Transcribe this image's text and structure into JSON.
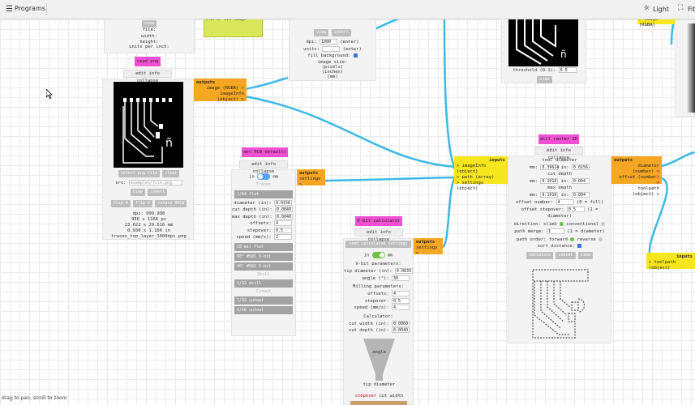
{
  "topbar": {
    "menu_icon": "hamburger-icon",
    "programs": "Programs",
    "light": "Light",
    "fit": "Fit",
    "sun_icon": "sun-icon",
    "fit_icon": "fit-icon"
  },
  "image_info_top": {
    "view": "view",
    "file": "file:",
    "width": "width:",
    "height": "height:",
    "units": "units per inch:"
  },
  "read_png": {
    "title": "read png",
    "strip": "edit info collapse",
    "select": "select png file",
    "clear": "clear",
    "src_label": "src:",
    "src_placeholder": "examples/file.png",
    "view": "view",
    "invert": "invert",
    "flip_h": "flip H",
    "flip_v": "flip V",
    "rotate": "rotate 90CW",
    "dpi": "dpi:  999.998",
    "px": "930 x 1166 px",
    "mm": "23.622 x 29.616 mm",
    "in": "0.930 x 1.166 in",
    "filename": "traces_top_layer_1000dpi.png"
  },
  "read_png_outputs": {
    "title": "outputs",
    "o1": "image (RGBA) >",
    "o2": "imageInfo (object) >"
  },
  "note_box": {
    "text": "PNG or SVG image"
  },
  "convert": {
    "view": "view",
    "invert": "invert",
    "dpi_label": "dpi:",
    "dpi_val": "1000",
    "dpi_note": "(enter)",
    "units_label": "units:",
    "units_note": "(enter)",
    "fill": "fill background:",
    "image_size": "image size:",
    "pixels": "(pixels)",
    "inches": "(inches)",
    "mm": "(mm)"
  },
  "threshold": {
    "label": "threshold (0-1):",
    "value": "0.5",
    "view": "view"
  },
  "top_right_out": {
    "text": "> image (RGBA)"
  },
  "pcb": {
    "title": "set PCB defaults",
    "strip": "edit info collapse",
    "in": "in",
    "mm": "mm",
    "traces": "Traces",
    "flat": "1/64 flat",
    "diameter": "diameter (in):",
    "diameter_val": "0.0156",
    "cut_depth": "cut depth (in):",
    "cut_depth_val": "0.0040",
    "max_depth": "max depth (in):",
    "max_depth_val": "0.0040",
    "offsets": "offsets:",
    "offsets_val": "4",
    "stepover": "stepover:",
    "stepover_val": "0.5",
    "speed": "speed (mm/s):",
    "speed_val": "2",
    "t1": "10 mil flat",
    "t2": "60° #501 V-bit",
    "t3": "40° #502 V-bit",
    "drill": "Drill",
    "d1": "1/32 drill",
    "cutout": "Cutout",
    "c1": "1/32 cutout",
    "c2": "1/16 cutout"
  },
  "pcb_outputs": {
    "title": "outputs",
    "o1": "settings >"
  },
  "vbit": {
    "title": "V-bit calculator",
    "strip": "edit info collapse",
    "send": "send calculated settings",
    "in": "in",
    "mm": "mm",
    "params": "V-bit parameters:",
    "tip": "tip diameter (in):",
    "tip_val": "0.0039",
    "angle": "angle (°):",
    "angle_val": "30",
    "milling": "Milling parameters:",
    "offsets": "offsets:",
    "offsets_val": "4",
    "stepover": "stepover:",
    "stepover_val": "0.5",
    "speed": "speed (mm/s):",
    "speed_val": "4",
    "calculator": "Calculator:",
    "cut_width": "cut width (in):",
    "cut_width_val": "0.0060",
    "cut_depth": "cut depth (in):",
    "cut_depth_val": "0.0040",
    "angle_word": "angle",
    "tip_diameter": "tip diameter",
    "stepover_word": "stepover",
    "cut_width_word": "cut width"
  },
  "vbit_outputs": {
    "title": "outputs",
    "o1": "settings >"
  },
  "mill_inputs": {
    "title": "inputs",
    "i1": "> imageInfo (object)",
    "i2": "> path (array)",
    "i3": "> settings (object)"
  },
  "mill": {
    "title": "mill raster 2D",
    "strip": "edit info collapse",
    "tool_diameter": "tool diameter",
    "mm_label": "mm:",
    "td_mm": "0.39624",
    "in_label": "in:",
    "td_in": "0.0156",
    "cut_depth": "cut depth",
    "cd_mm": "0.1016",
    "cd_in": "0.004",
    "max_depth": "max depth",
    "md_mm": "0.1016",
    "md_in": "0.004",
    "offset_number": "offset number:",
    "on_val": "4",
    "on_note": "(0 = fill)",
    "offset_stepover": "offset stepover:",
    "os_val": "0.5",
    "os_note": "(1 = diameter)",
    "direction": "direction: climb",
    "conventional": "conventional",
    "path_merge": "path merge:",
    "pm_val": "1",
    "pm_note": "(1 = diameter)",
    "path_order": "path order: forward",
    "reverse": "reverse",
    "sort": "sort distance:",
    "calculate": "calculate",
    "cancel": "cancel",
    "view": "view"
  },
  "mill_outputs": {
    "title": "outputs",
    "o1": "diameter (number) >",
    "o2": "offset (number) >",
    "o3": "toolpath (object) >"
  },
  "right_inputs": {
    "title": "inputs",
    "i1": "> toolpath (object)"
  },
  "status": "drag to pan, scroll to zoom",
  "colors": {
    "wire": "#3cb9e6",
    "title": "#f04fd2",
    "output": "#f5a623",
    "input": "#f6e61d"
  }
}
